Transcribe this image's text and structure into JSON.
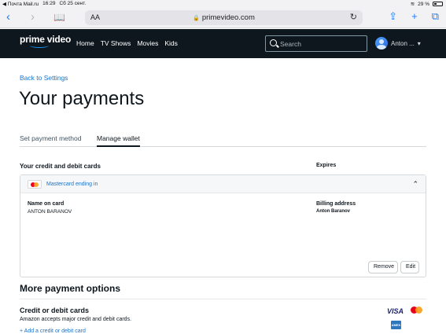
{
  "status_bar": {
    "carrier": "◀ Почта Mail.ru",
    "time": "16:29",
    "date": "Сб 25 сент.",
    "battery": "29 %"
  },
  "browser": {
    "text_size_label": "AA",
    "url": "primevideo.com",
    "icons": [
      "back-icon",
      "forward-icon",
      "bookmarks-icon",
      "lock-icon",
      "reload-icon",
      "share-icon",
      "new-tab-icon",
      "tabs-icon"
    ]
  },
  "header": {
    "logo_text": "prime video",
    "nav": [
      "Home",
      "TV Shows",
      "Movies",
      "Kids"
    ],
    "search_placeholder": "Search",
    "account_name": "Anton ..."
  },
  "page": {
    "back_link": "Back to Settings",
    "title": "Your payments",
    "tabs": [
      "Set payment method",
      "Manage wallet"
    ],
    "active_tab": "Manage wallet"
  },
  "cards": {
    "heading": "Your credit and debit cards",
    "expires_heading": "Expires",
    "card_label": "Mastercard ending in",
    "name_label": "Name on card",
    "name_value": "ANTON BARANOV",
    "billing_label": "Billing address",
    "billing_value": "Anton Baranov",
    "remove_label": "Remove",
    "edit_label": "Edit"
  },
  "more_options": {
    "heading": "More payment options",
    "cc_heading": "Credit or debit cards",
    "cc_desc": "Amazon accepts major credit and debit cards.",
    "add_card": "+ Add a credit or debit card",
    "visa_label": "VISA",
    "amex_label": "AMEX"
  },
  "colors": {
    "header_bg": "#0f171e",
    "link": "#1a73c9",
    "ios_accent": "#1a7cff"
  }
}
